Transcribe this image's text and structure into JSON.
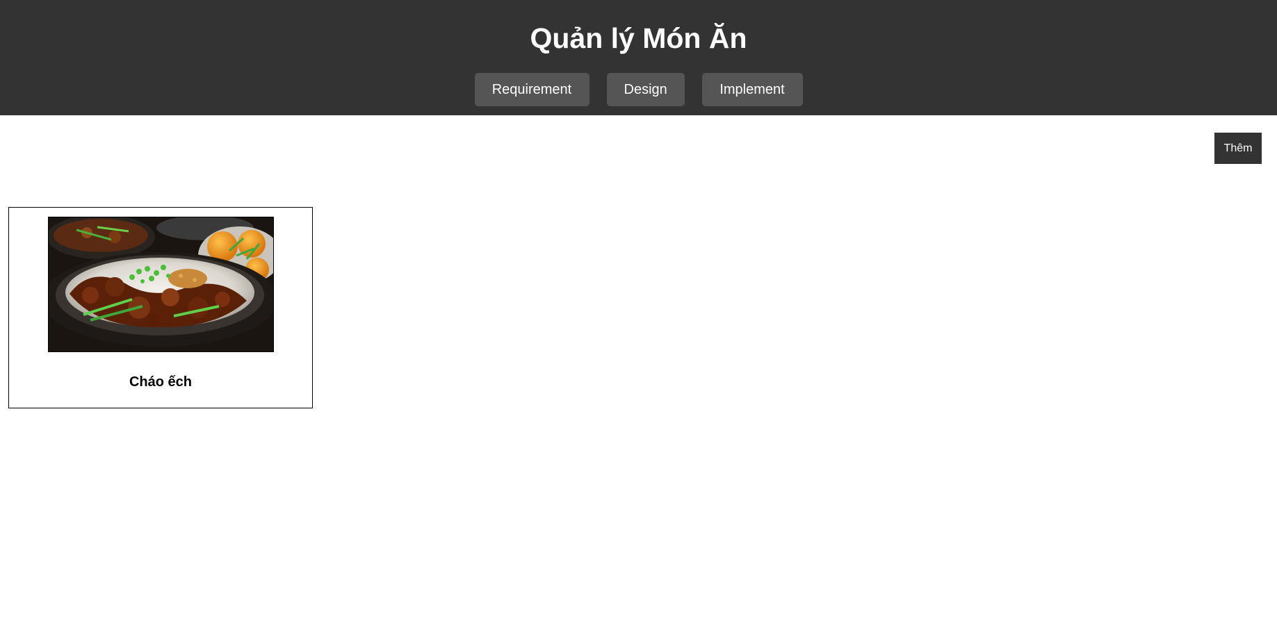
{
  "header": {
    "title": "Quản lý Món Ăn",
    "nav": [
      {
        "label": "Requirement"
      },
      {
        "label": "Design"
      },
      {
        "label": "Implement"
      }
    ]
  },
  "actions": {
    "add_label": "Thêm"
  },
  "dishes": [
    {
      "name": "Cháo ếch",
      "image": "dish-photo"
    }
  ],
  "colors": {
    "header_bg": "#333333",
    "nav_button_bg": "#555555",
    "add_button_bg": "#333333",
    "text_light": "#ffffff"
  }
}
